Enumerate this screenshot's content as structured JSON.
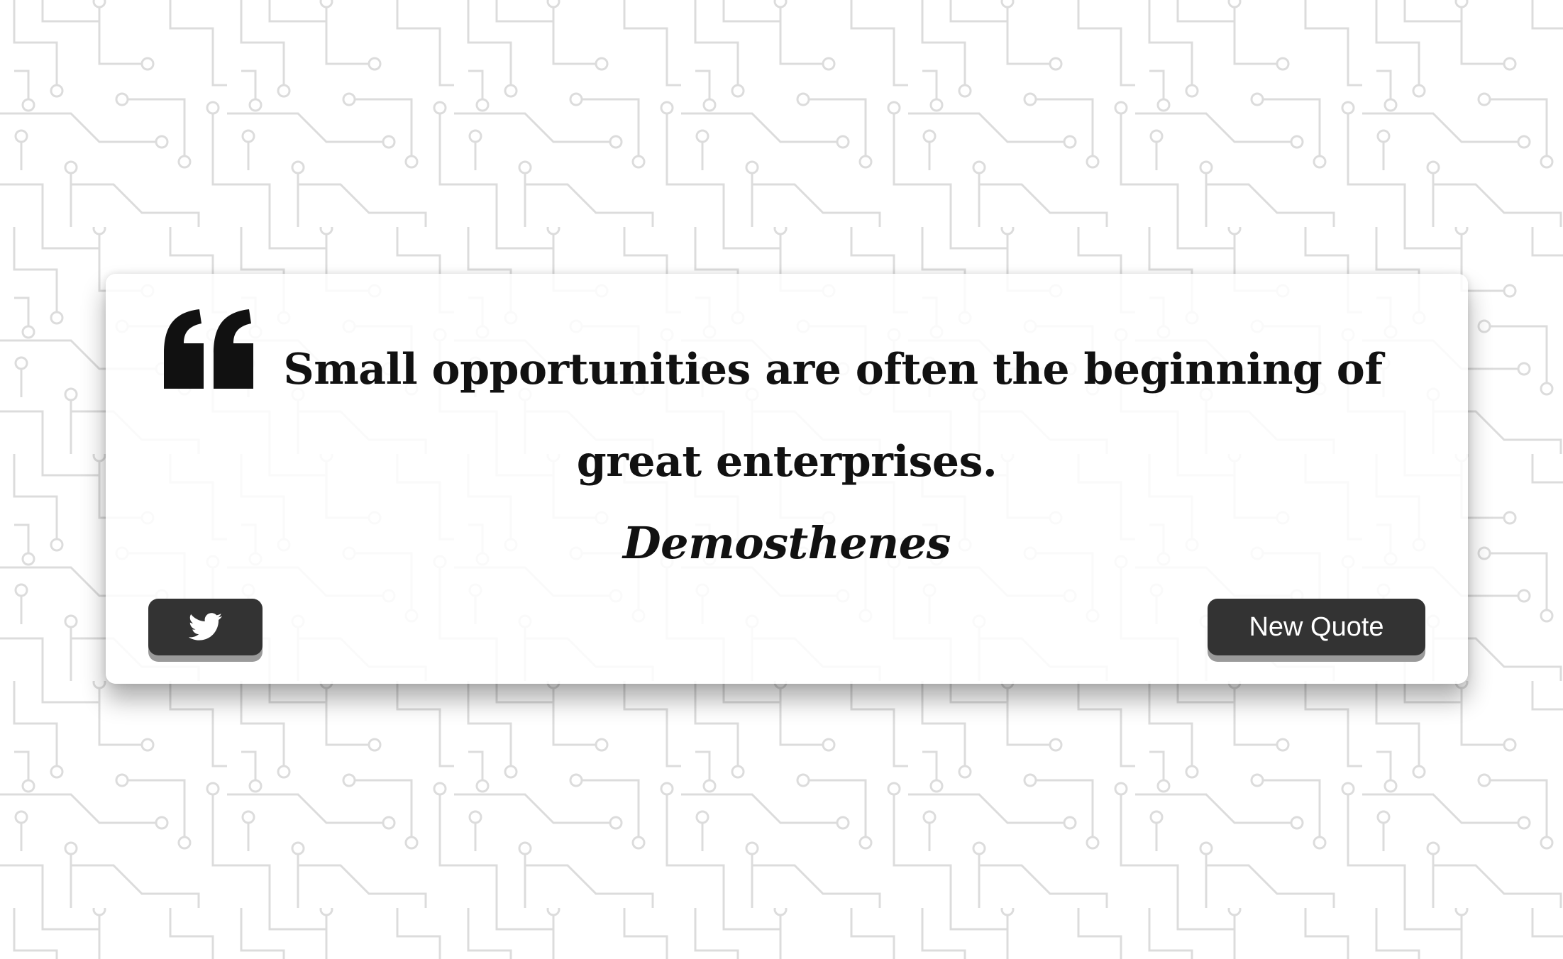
{
  "quote": {
    "text": "Small opportunities are often the beginning of great enterprises.",
    "author": "Demosthenes"
  },
  "buttons": {
    "new_quote_label": "New Quote"
  },
  "icons": {
    "quote": "quote-left-icon",
    "tweet": "twitter-bird-icon"
  },
  "colors": {
    "background": "#ffffff",
    "pattern": "#dddddd",
    "card": "#ffffff",
    "text": "#111111",
    "button": "#333333",
    "button_shadow": "#9a9a9a",
    "button_text": "#ffffff"
  }
}
